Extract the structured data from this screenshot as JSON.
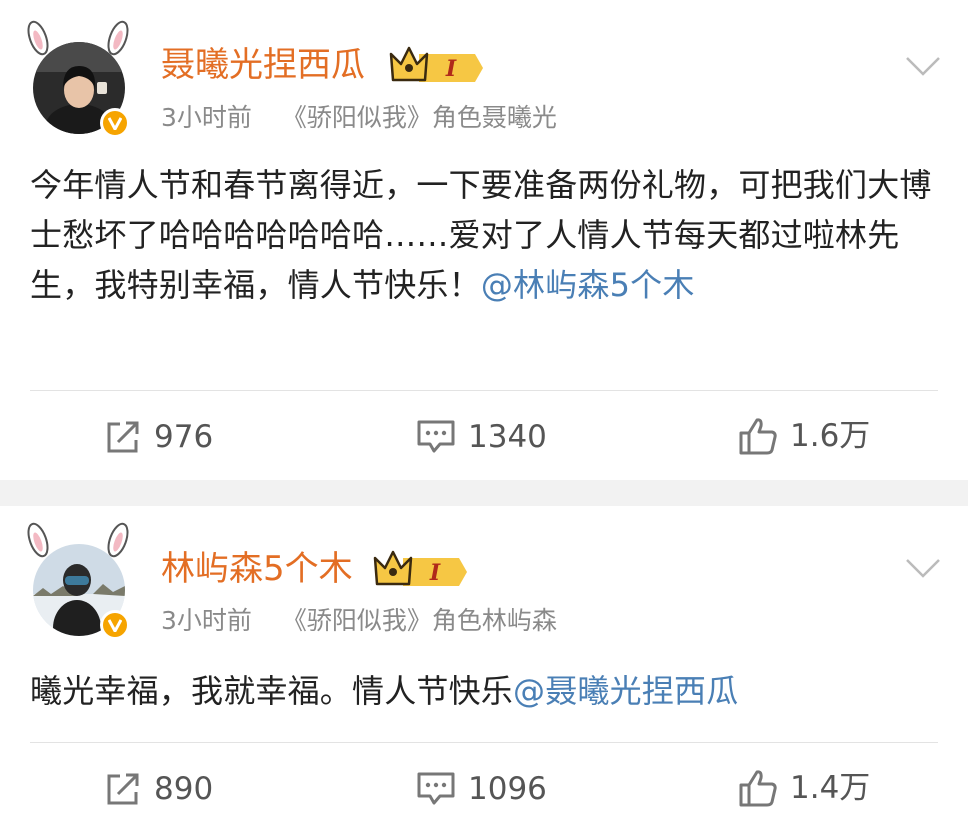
{
  "posts": [
    {
      "username": "聂曦光捏西瓜",
      "level": "I",
      "time": "3小时前",
      "source": "《骄阳似我》角色聂曦光",
      "text": "今年情人节和春节离得近，一下要准备两份礼物，可把我们大博士愁坏了哈哈哈哈哈哈哈……爱对了人情人节每天都过啦林先生，我特别幸福，情人节快乐！",
      "mention": "@林屿森5个木",
      "reposts": "976",
      "comments": "1340",
      "likes": "1.6万"
    },
    {
      "username": "林屿森5个木",
      "level": "I",
      "time": "3小时前",
      "source": "《骄阳似我》角色林屿森",
      "text": "曦光幸福，我就幸福。情人节快乐",
      "mention": "@聂曦光捏西瓜",
      "reposts": "890",
      "comments": "1096",
      "likes": "1.4万"
    }
  ],
  "colors": {
    "username": "#e36e24",
    "mention": "#4a7fb5",
    "meta": "#8a8a8a",
    "verified_badge": "#f6a400",
    "ears": "#f3b9c3"
  },
  "icons": {
    "verified": "verified-v-icon",
    "level": "crown-level-icon",
    "menu": "chevron-down-icon",
    "repost": "repost-icon",
    "comment": "comment-icon",
    "like": "like-icon",
    "decoration": "bunny-ears-icon"
  }
}
